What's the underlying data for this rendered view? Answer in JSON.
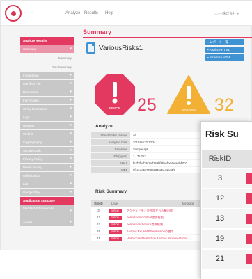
{
  "nav": {
    "analyze": "Analyze",
    "results": "Results",
    "help": "Help",
    "user": "○○○○株式会社 ▾"
  },
  "colors": {
    "accent": "#e3385f",
    "warning": "#f2b134",
    "link": "#3f93d3"
  },
  "sidebar": {
    "section1": "Analyze Results",
    "summary": "Summary",
    "sub1": "Summary",
    "sub2": "Risk Summary",
    "items": [
      "Information",
      "Manifest File",
      "Permission",
      "File Access",
      "String Resources",
      "Logs",
      "Network",
      "WebKit",
      "Cryptography",
      "Secure Logic",
      "Privacy Policy",
      "Power Saving",
      "Obfuscation",
      "Lint",
      "Google Play"
    ],
    "section2": "Application Structure",
    "items2": [
      "Manifest & Resources",
      "Assets"
    ]
  },
  "main": {
    "summary_title": "Summary",
    "app_name": "VariousRisks1",
    "buttons": [
      "レポート一覧",
      "Analyze HTML",
      "Structure HTML"
    ],
    "error_label": "ERROR",
    "error_count": "25",
    "warning_label": "WARNING",
    "warning_count": "32",
    "analyze_title": "Analyze",
    "analyze_rows": [
      {
        "key": "ShieldFinder Version",
        "val": "46"
      },
      {
        "key": "Analyzed Date",
        "val": "2015/04/22 10:24"
      },
      {
        "key": "FileName",
        "val": "Sample.apk"
      },
      {
        "key": "File(bytes)",
        "val": "1,175,213"
      },
      {
        "key": "SHA1",
        "val": "fe2f7fb4f26f1ad289bf8baefbe4e6ebbb0c0"
      },
      {
        "key": "MD5",
        "val": "9fccede5c70f0833463a1c1a43f9"
      }
    ],
    "risk_summary_title": "Risk Summary",
    "risk_headers": [
      "RiskID",
      "Level",
      "Message"
    ],
    "risk_rows": [
      {
        "id": "3",
        "level": "ERROR",
        "msg": "アクティビティが外部から起動可能"
      },
      {
        "id": "12",
        "level": "ERROR",
        "msg": "permission.Content提供権限"
      },
      {
        "id": "13",
        "level": "ERROR",
        "msg": "permission.Service提供権限"
      },
      {
        "id": "19",
        "level": "ERROR",
        "msg": "Android.Ext.jetWRPermissionの使用"
      },
      {
        "id": "21",
        "level": "ERROR",
        "msg": "HostAccessRestriction.Android.Implementation"
      }
    ]
  },
  "zoom": {
    "title": "Risk Su",
    "header_id": "RiskID",
    "ids": [
      "3",
      "12",
      "13",
      "19",
      "21"
    ]
  }
}
